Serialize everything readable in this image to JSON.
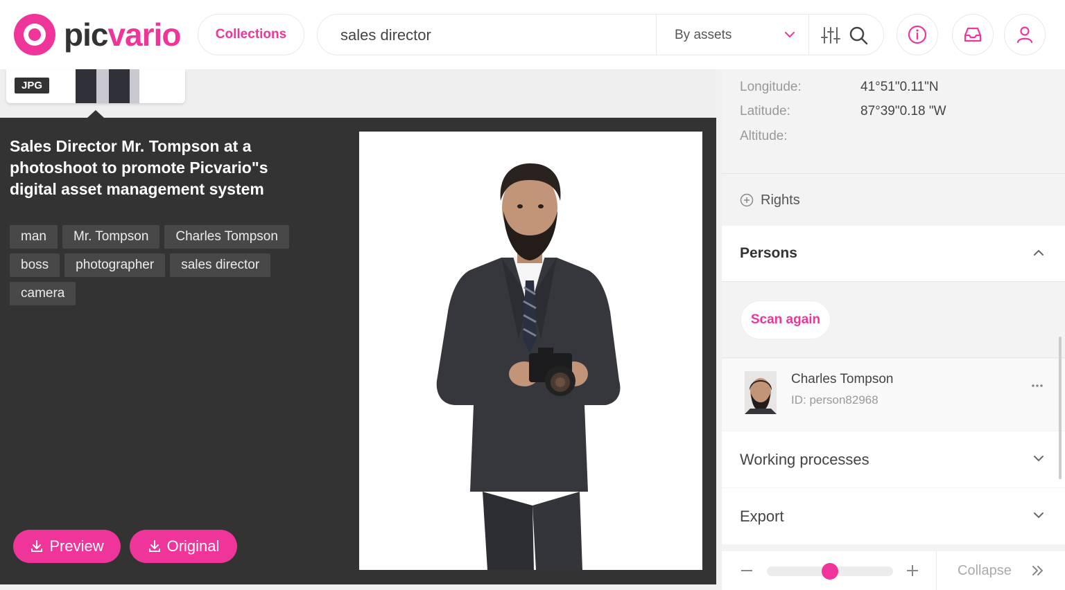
{
  "header": {
    "logo_text_dark": "pic",
    "logo_text_pink": "vario",
    "collections_label": "Collections",
    "search_value": "sales director",
    "search_scope": "By assets",
    "icons": [
      "filters-icon",
      "search-icon",
      "info-icon",
      "inbox-icon",
      "user-icon"
    ]
  },
  "thumbnail": {
    "format_badge": "JPG"
  },
  "asset": {
    "title": "Sales Director Mr. Tompson at a photoshoot to promote Picvario\"s digital asset management system",
    "tags": [
      "man",
      "Mr. Tompson",
      "Charles Tompson",
      "boss",
      "photographer",
      "sales director",
      "camera"
    ],
    "preview_label": "Preview",
    "original_label": "Original"
  },
  "details": {
    "longitude_label": "Longitude:",
    "longitude_value": "41°51\"0.11\"N",
    "latitude_label": "Latitude:",
    "latitude_value": "87°39\"0.18 \"W",
    "altitude_label": "Altitude:",
    "rights_label": "Rights"
  },
  "persons": {
    "title": "Persons",
    "scan_label": "Scan again",
    "list": [
      {
        "name": "Charles Tompson",
        "id": "ID: person82968"
      }
    ]
  },
  "sections": {
    "working_processes": "Working processes",
    "export": "Export"
  },
  "footer": {
    "zoom_level": 0.5,
    "collapse_label": "Collapse"
  },
  "colors": {
    "accent": "#f0359a",
    "dark_panel": "#333333",
    "tag_bg": "#484848"
  }
}
